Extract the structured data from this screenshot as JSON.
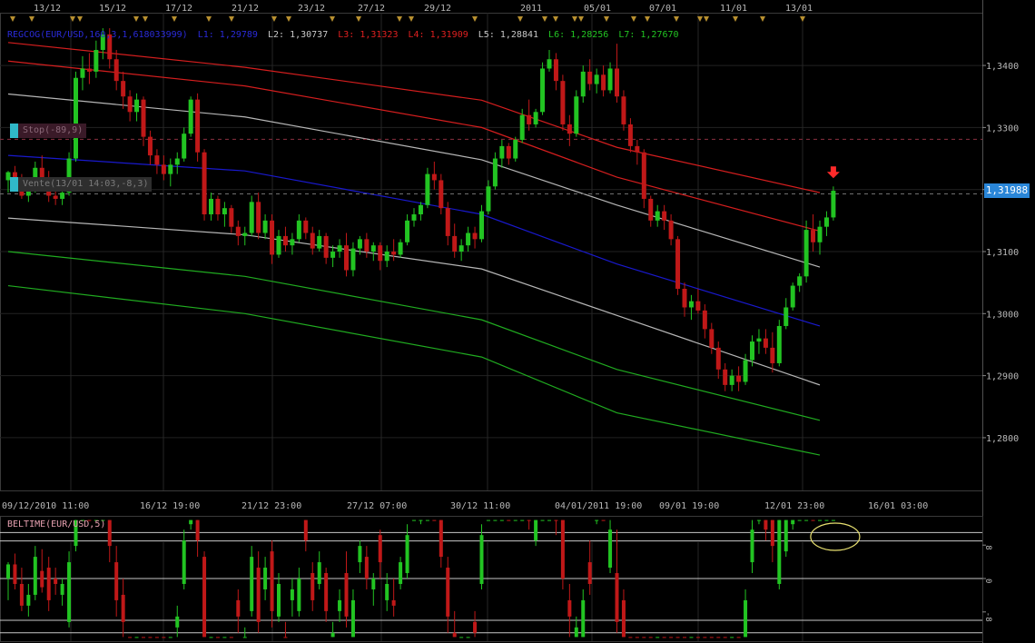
{
  "colors": {
    "bull": "#22c422",
    "bear": "#c01818",
    "grid": "#2a2a2a",
    "axis_text": "#b8b8b8",
    "L1": "#1a1ad8",
    "L2": "#c0c0c0",
    "L3": "#e02020",
    "L4": "#e02020",
    "L5": "#c0c0c0",
    "L6": "#22b422",
    "L7": "#22b422",
    "ellipse": "#e8e070",
    "signal_arrow": "#ff2a2a"
  },
  "legend": {
    "title": "REGCOG(EUR/USD,160,3,1,618033999)",
    "L1": "L1: 1,29789",
    "L2": "L2: 1,30737",
    "L3": "L3: 1,31323",
    "L4": "L4: 1,31909",
    "L5": "L5: 1,28841",
    "L6": "L6: 1,28256",
    "L7": "L7: 1,27670"
  },
  "tags": {
    "stop": "Stop(-89,9)",
    "vente": "Vente(13/01 14:03,-8,3)"
  },
  "last_price": "1,31988",
  "indicator": {
    "title": "BELTIME(EUR/USD,5)",
    "ticks": [
      "8",
      "0",
      "-8"
    ]
  },
  "chart_data": {
    "type": "candlestick",
    "symbol": "EUR/USD",
    "top_axis_labels": [
      "13/12",
      "15/12",
      "17/12",
      "21/12",
      "23/12",
      "27/12",
      "29/12",
      "2011",
      "05/01",
      "07/01",
      "11/01",
      "13/01"
    ],
    "bottom_axis_labels": [
      "09/12/2010 11:00",
      "16/12 19:00",
      "21/12 23:00",
      "27/12 07:00",
      "30/12 11:00",
      "04/01/2011 19:00",
      "09/01 19:00",
      "12/01 23:00",
      "16/01 03:00"
    ],
    "y_ticks": [
      "1,3400",
      "1,3300",
      "1,3200",
      "1,3100",
      "1,3000",
      "1,2900",
      "1,2800"
    ],
    "ylim": [
      1.2715,
      1.3485
    ],
    "last_price": 1.31988,
    "stop_level": 1.3281,
    "entry_level": 1.3193,
    "regression_channel": {
      "name": "REGCOG(EUR/USD,160,3,1,618033999)",
      "lines": [
        {
          "name": "L4",
          "points": [
            [
              0,
              1.3437
            ],
            [
              35,
              1.3397
            ],
            [
              70,
              1.3344
            ],
            [
              90,
              1.3268
            ],
            [
              120,
              1.3195
            ]
          ]
        },
        {
          "name": "L3",
          "points": [
            [
              0,
              1.3407
            ],
            [
              35,
              1.3367
            ],
            [
              70,
              1.33
            ],
            [
              90,
              1.322
            ],
            [
              120,
              1.3133
            ]
          ]
        },
        {
          "name": "L2",
          "points": [
            [
              0,
              1.3354
            ],
            [
              35,
              1.3317
            ],
            [
              70,
              1.3248
            ],
            [
              90,
              1.3175
            ],
            [
              120,
              1.3075
            ]
          ]
        },
        {
          "name": "L1",
          "points": [
            [
              0,
              1.3255
            ],
            [
              35,
              1.323
            ],
            [
              70,
              1.316
            ],
            [
              90,
              1.308
            ],
            [
              120,
              1.298
            ]
          ]
        },
        {
          "name": "L5",
          "points": [
            [
              0,
              1.3154
            ],
            [
              35,
              1.3127
            ],
            [
              70,
              1.3072
            ],
            [
              90,
              1.2997
            ],
            [
              120,
              1.2885
            ]
          ]
        },
        {
          "name": "L6",
          "points": [
            [
              0,
              1.31
            ],
            [
              35,
              1.306
            ],
            [
              70,
              1.299
            ],
            [
              90,
              1.291
            ],
            [
              120,
              1.2828
            ]
          ]
        },
        {
          "name": "L7",
          "points": [
            [
              0,
              1.3045
            ],
            [
              35,
              1.3
            ],
            [
              70,
              1.293
            ],
            [
              90,
              1.284
            ],
            [
              120,
              1.2772
            ]
          ]
        }
      ]
    },
    "candles": [
      [
        1.3215,
        1.323,
        1.3195,
        1.3228
      ],
      [
        1.3228,
        1.3238,
        1.3205,
        1.321
      ],
      [
        1.321,
        1.3225,
        1.3185,
        1.319
      ],
      [
        1.319,
        1.321,
        1.318,
        1.32
      ],
      [
        1.32,
        1.3245,
        1.3195,
        1.3235
      ],
      [
        1.3235,
        1.3255,
        1.3215,
        1.322
      ],
      [
        1.322,
        1.323,
        1.318,
        1.319
      ],
      [
        1.319,
        1.32,
        1.3175,
        1.3185
      ],
      [
        1.3185,
        1.32,
        1.3175,
        1.3195
      ],
      [
        1.3195,
        1.326,
        1.319,
        1.325
      ],
      [
        1.325,
        1.339,
        1.3245,
        1.338
      ],
      [
        1.338,
        1.3415,
        1.336,
        1.3395
      ],
      [
        1.3395,
        1.342,
        1.337,
        1.339
      ],
      [
        1.339,
        1.344,
        1.338,
        1.3425
      ],
      [
        1.3425,
        1.346,
        1.341,
        1.345
      ],
      [
        1.345,
        1.346,
        1.3395,
        1.341
      ],
      [
        1.341,
        1.3425,
        1.336,
        1.3375
      ],
      [
        1.3375,
        1.339,
        1.333,
        1.335
      ],
      [
        1.335,
        1.336,
        1.331,
        1.3325
      ],
      [
        1.3325,
        1.3355,
        1.331,
        1.3345
      ],
      [
        1.3345,
        1.335,
        1.327,
        1.3285
      ],
      [
        1.3285,
        1.3295,
        1.324,
        1.3255
      ],
      [
        1.3255,
        1.3265,
        1.3225,
        1.324
      ],
      [
        1.324,
        1.3255,
        1.3215,
        1.3225
      ],
      [
        1.3225,
        1.325,
        1.3205,
        1.324
      ],
      [
        1.324,
        1.326,
        1.3225,
        1.325
      ],
      [
        1.325,
        1.33,
        1.3245,
        1.329
      ],
      [
        1.329,
        1.335,
        1.3285,
        1.3345
      ],
      [
        1.3345,
        1.3355,
        1.3245,
        1.326
      ],
      [
        1.326,
        1.3265,
        1.315,
        1.316
      ],
      [
        1.316,
        1.3195,
        1.315,
        1.3185
      ],
      [
        1.3185,
        1.319,
        1.315,
        1.316
      ],
      [
        1.316,
        1.318,
        1.314,
        1.317
      ],
      [
        1.317,
        1.3175,
        1.313,
        1.314
      ],
      [
        1.314,
        1.315,
        1.311,
        1.3125
      ],
      [
        1.3125,
        1.314,
        1.311,
        1.313
      ],
      [
        1.313,
        1.319,
        1.3125,
        1.318
      ],
      [
        1.318,
        1.3195,
        1.312,
        1.313
      ],
      [
        1.313,
        1.316,
        1.312,
        1.315
      ],
      [
        1.315,
        1.316,
        1.308,
        1.3095
      ],
      [
        1.3095,
        1.3135,
        1.309,
        1.3125
      ],
      [
        1.3125,
        1.314,
        1.31,
        1.311
      ],
      [
        1.311,
        1.313,
        1.3095,
        1.312
      ],
      [
        1.312,
        1.316,
        1.3115,
        1.315
      ],
      [
        1.315,
        1.3155,
        1.312,
        1.313
      ],
      [
        1.313,
        1.314,
        1.3095,
        1.3105
      ],
      [
        1.3105,
        1.3135,
        1.31,
        1.3125
      ],
      [
        1.3125,
        1.313,
        1.308,
        1.309
      ],
      [
        1.309,
        1.311,
        1.3075,
        1.31
      ],
      [
        1.31,
        1.312,
        1.309,
        1.311
      ],
      [
        1.311,
        1.313,
        1.306,
        1.307
      ],
      [
        1.307,
        1.3115,
        1.306,
        1.3105
      ],
      [
        1.3105,
        1.3125,
        1.3095,
        1.312
      ],
      [
        1.312,
        1.313,
        1.309,
        1.31
      ],
      [
        1.31,
        1.3115,
        1.3085,
        1.311
      ],
      [
        1.311,
        1.3115,
        1.307,
        1.3085
      ],
      [
        1.3085,
        1.311,
        1.3075,
        1.31
      ],
      [
        1.31,
        1.312,
        1.3085,
        1.3095
      ],
      [
        1.3095,
        1.312,
        1.309,
        1.3115
      ],
      [
        1.3115,
        1.316,
        1.311,
        1.315
      ],
      [
        1.315,
        1.317,
        1.314,
        1.316
      ],
      [
        1.316,
        1.318,
        1.315,
        1.3175
      ],
      [
        1.3175,
        1.3235,
        1.317,
        1.3225
      ],
      [
        1.3225,
        1.3245,
        1.32,
        1.3215
      ],
      [
        1.3215,
        1.3225,
        1.316,
        1.317
      ],
      [
        1.317,
        1.318,
        1.311,
        1.3125
      ],
      [
        1.3125,
        1.3145,
        1.309,
        1.31
      ],
      [
        1.31,
        1.312,
        1.3085,
        1.311
      ],
      [
        1.311,
        1.314,
        1.31,
        1.313
      ],
      [
        1.313,
        1.314,
        1.3105,
        1.312
      ],
      [
        1.312,
        1.3175,
        1.3115,
        1.3165
      ],
      [
        1.3165,
        1.3215,
        1.316,
        1.3205
      ],
      [
        1.3205,
        1.326,
        1.32,
        1.325
      ],
      [
        1.325,
        1.328,
        1.3235,
        1.327
      ],
      [
        1.327,
        1.3275,
        1.324,
        1.325
      ],
      [
        1.325,
        1.3285,
        1.3245,
        1.328
      ],
      [
        1.328,
        1.333,
        1.3275,
        1.332
      ],
      [
        1.332,
        1.3345,
        1.3295,
        1.3305
      ],
      [
        1.3305,
        1.333,
        1.33,
        1.3325
      ],
      [
        1.3325,
        1.3405,
        1.332,
        1.3395
      ],
      [
        1.3395,
        1.3425,
        1.339,
        1.341
      ],
      [
        1.341,
        1.342,
        1.336,
        1.3375
      ],
      [
        1.3375,
        1.3385,
        1.3295,
        1.3305
      ],
      [
        1.3305,
        1.332,
        1.327,
        1.329
      ],
      [
        1.329,
        1.336,
        1.3285,
        1.335
      ],
      [
        1.335,
        1.34,
        1.334,
        1.339
      ],
      [
        1.339,
        1.341,
        1.336,
        1.337
      ],
      [
        1.337,
        1.3395,
        1.3355,
        1.3385
      ],
      [
        1.3385,
        1.34,
        1.335,
        1.336
      ],
      [
        1.336,
        1.3405,
        1.3355,
        1.3395
      ],
      [
        1.3395,
        1.3435,
        1.334,
        1.335
      ],
      [
        1.335,
        1.336,
        1.3295,
        1.3305
      ],
      [
        1.3305,
        1.3315,
        1.326,
        1.327
      ],
      [
        1.327,
        1.328,
        1.324,
        1.326
      ],
      [
        1.326,
        1.3265,
        1.317,
        1.3185
      ],
      [
        1.3185,
        1.319,
        1.314,
        1.315
      ],
      [
        1.315,
        1.3175,
        1.314,
        1.3165
      ],
      [
        1.3165,
        1.3175,
        1.3135,
        1.315
      ],
      [
        1.315,
        1.316,
        1.311,
        1.312
      ],
      [
        1.312,
        1.3125,
        1.303,
        1.304
      ],
      [
        1.304,
        1.305,
        1.2995,
        1.301
      ],
      [
        1.301,
        1.303,
        1.299,
        1.302
      ],
      [
        1.302,
        1.304,
        1.3,
        1.3005
      ],
      [
        1.3005,
        1.3015,
        1.296,
        1.2975
      ],
      [
        1.2975,
        1.2985,
        1.2935,
        1.2945
      ],
      [
        1.2945,
        1.2955,
        1.2895,
        1.291
      ],
      [
        1.291,
        1.292,
        1.2875,
        1.2885
      ],
      [
        1.2885,
        1.291,
        1.2875,
        1.29
      ],
      [
        1.29,
        1.2915,
        1.2875,
        1.289
      ],
      [
        1.289,
        1.2935,
        1.2885,
        1.2925
      ],
      [
        1.2925,
        1.2965,
        1.2915,
        1.2955
      ],
      [
        1.2955,
        1.2975,
        1.2935,
        1.296
      ],
      [
        1.296,
        1.2975,
        1.2935,
        1.2945
      ],
      [
        1.2945,
        1.297,
        1.2905,
        1.292
      ],
      [
        1.292,
        1.299,
        1.2915,
        1.298
      ],
      [
        1.298,
        1.3025,
        1.2975,
        1.301
      ],
      [
        1.301,
        1.305,
        1.3005,
        1.3045
      ],
      [
        1.3045,
        1.3065,
        1.3035,
        1.306
      ],
      [
        1.306,
        1.315,
        1.305,
        1.3135
      ],
      [
        1.3135,
        1.316,
        1.31,
        1.3115
      ],
      [
        1.3115,
        1.315,
        1.3095,
        1.314
      ],
      [
        1.314,
        1.3165,
        1.3125,
        1.3155
      ],
      [
        1.3155,
        1.3205,
        1.315,
        1.3198
      ]
    ],
    "indicator": {
      "name": "BELTIME(EUR/USD,5)",
      "y_ticks": [
        8,
        0,
        -8
      ],
      "ylim": [
        -15,
        15
      ],
      "levels": [
        11,
        9,
        0,
        -10,
        -13
      ]
    }
  }
}
